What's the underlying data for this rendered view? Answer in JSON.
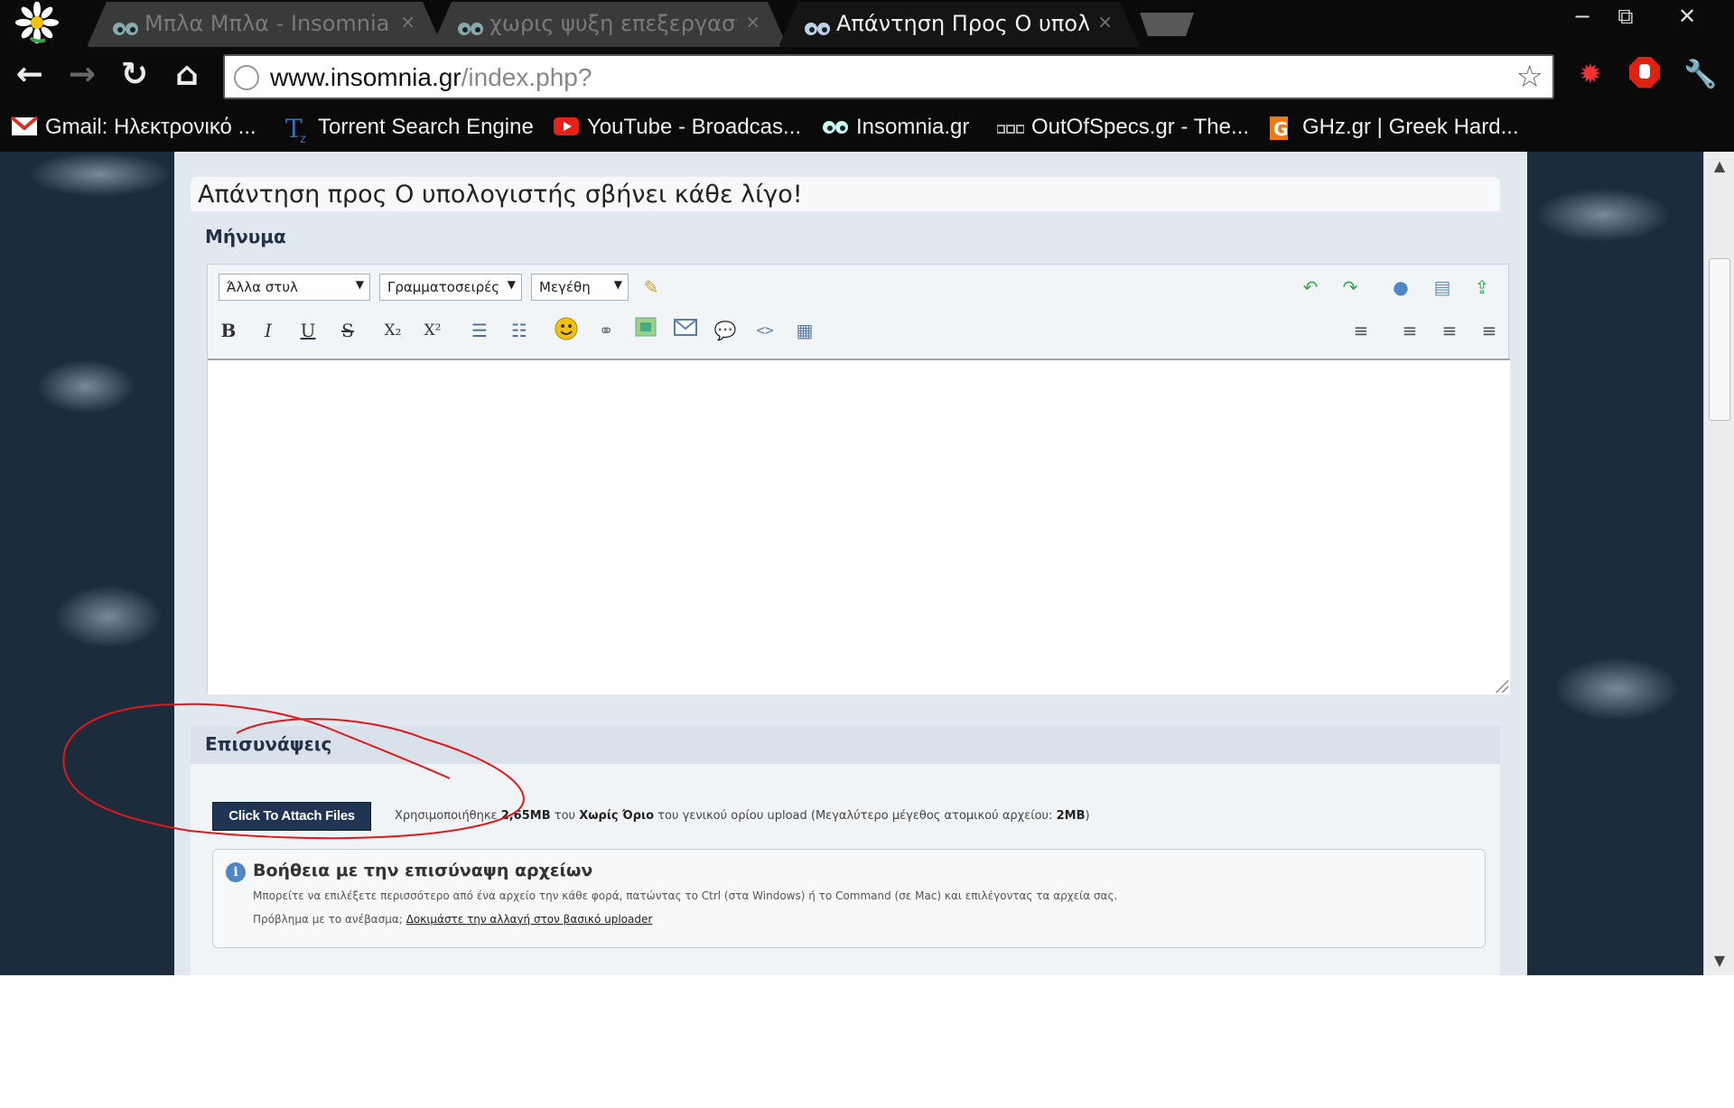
{
  "browser": {
    "tabs": [
      {
        "label": "Μπλα Μπλα - Insomnia.gr",
        "active": false
      },
      {
        "label": "χωρις ψυξη επεξεργαστη",
        "active": false
      },
      {
        "label": "Απάντηση Προς Ο υπολο",
        "active": true
      }
    ],
    "tab_close": "×",
    "window_controls": {
      "minimize": "−",
      "restore": "⧉",
      "close": "✕"
    },
    "nav": {
      "back": "←",
      "forward": "→",
      "reload": "↻",
      "home": "⌂"
    },
    "url": {
      "host": "www.insomnia.gr",
      "path": "/index.php?"
    },
    "bookmarks": [
      {
        "label": "Gmail: Ηλεκτρονικό ...",
        "icon": "gmail-icon",
        "color": "#d93025"
      },
      {
        "label": "Torrent Search Engine",
        "icon": "torrentz-icon",
        "color": "#3a6fb0"
      },
      {
        "label": "YouTube - Broadcas...",
        "icon": "youtube-icon",
        "color": "#e62117"
      },
      {
        "label": "Insomnia.gr",
        "icon": "insomnia-icon",
        "color": "#9fb3c8"
      },
      {
        "label": "OutOfSpecs.gr - The...",
        "icon": "outofspecs-icon",
        "color": "#8a8a8a"
      },
      {
        "label": "GHz.gr | Greek Hard...",
        "icon": "ghz-icon",
        "color": "#f07a12"
      }
    ]
  },
  "page": {
    "reply_title": "Απάντηση προς Ο υπολογιστής σβήνει κάθε λίγο!",
    "message_label": "Μήνυμα",
    "editor": {
      "style_combo": "Άλλα στυλ",
      "font_combo": "Γραμματοσειρές",
      "size_combo": "Μεγέθη",
      "format_buttons": [
        "B",
        "I",
        "U",
        "S",
        "X₂",
        "X²"
      ]
    },
    "attachments_label": "Επισυνάψεις",
    "attach_button": "Click To Attach Files",
    "quota": {
      "prefix": "Χρησιμοποιήθηκε",
      "used": "2,65MB",
      "of": "του",
      "limit": "Χωρίς Όριο",
      "suffix": "του γενικού ορίου upload (Μεγαλύτερο μέγεθος ατομικού αρχείου:",
      "max_file": "2MB",
      "close": ")"
    },
    "help": {
      "title": "Βοήθεια με την επισύναψη αρχείων",
      "line1": "Μπορείτε να επιλέξετε περισσότερο από ένα αρχείο την κάθε φορά, πατώντας το Ctrl (στα Windows) ή το Command (σε Mac) και επιλέγοντας τα αρχεία σας.",
      "line2_prefix": "Πρόβλημα με το ανέβασμα;",
      "line2_link": "Δοκιμάστε την αλλαγή στον βασικό uploader"
    }
  },
  "colors": {
    "chrome_bg": "#0a0a0a",
    "page_bg": "#1d2c3c",
    "content_bg": "#e1e8ef",
    "button_bg": "#1f3553",
    "annotation": "#e01818"
  }
}
